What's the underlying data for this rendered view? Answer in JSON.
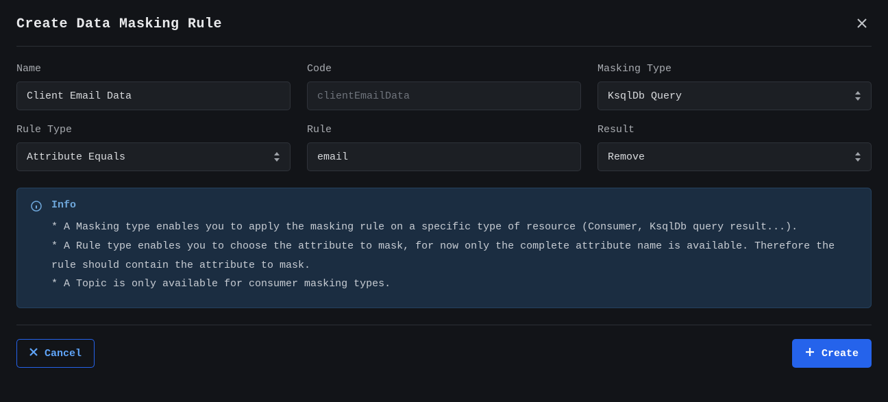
{
  "title": "Create Data Masking Rule",
  "fields": {
    "name": {
      "label": "Name",
      "value": "Client Email Data"
    },
    "code": {
      "label": "Code",
      "value": "clientEmailData"
    },
    "maskingType": {
      "label": "Masking Type",
      "value": "KsqlDb Query"
    },
    "ruleType": {
      "label": "Rule Type",
      "value": "Attribute Equals"
    },
    "rule": {
      "label": "Rule",
      "value": "email"
    },
    "result": {
      "label": "Result",
      "value": "Remove"
    }
  },
  "info": {
    "title": "Info",
    "body": "* A Masking type enables you to apply the masking rule on a specific type of resource (Consumer, KsqlDb query result...).\n* A Rule type enables you to choose the attribute to mask, for now only the complete attribute name is available. Therefore the rule should contain the attribute to mask.\n* A Topic is only available for consumer masking types."
  },
  "buttons": {
    "cancel": "Cancel",
    "create": "Create"
  }
}
